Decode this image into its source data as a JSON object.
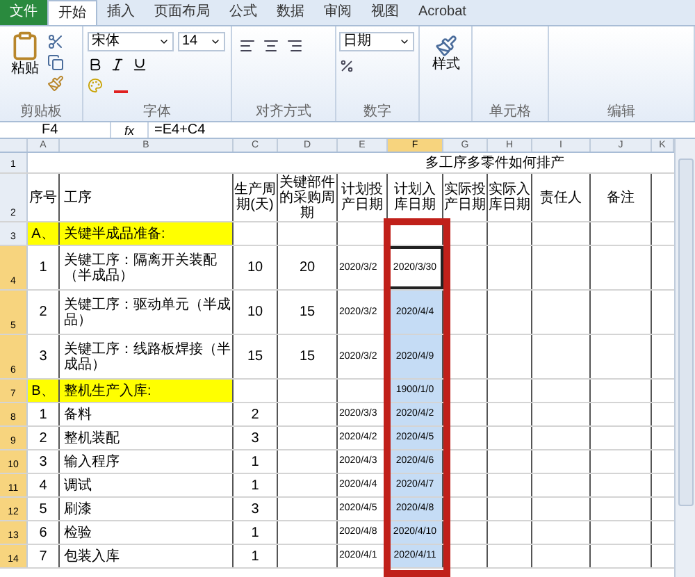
{
  "ribbon_tabs": [
    {
      "label": "文件",
      "kind": "file",
      "selected": false
    },
    {
      "label": "开始",
      "kind": "tab",
      "selected": true
    },
    {
      "label": "插入",
      "kind": "tab",
      "selected": false
    },
    {
      "label": "页面布局",
      "kind": "tab",
      "selected": false
    },
    {
      "label": "公式",
      "kind": "tab",
      "selected": false
    },
    {
      "label": "数据",
      "kind": "tab",
      "selected": false
    },
    {
      "label": "审阅",
      "kind": "tab",
      "selected": false
    },
    {
      "label": "视图",
      "kind": "tab",
      "selected": false
    },
    {
      "label": "Acrobat",
      "kind": "tab",
      "selected": false
    }
  ],
  "ribbon": {
    "paste_label": "粘贴",
    "font_name": "宋体",
    "font_size": "14",
    "number_format": "日期",
    "styles_label": "样式",
    "groups": [
      "剪贴板",
      "字体",
      "对齐方式",
      "数字",
      "单元格",
      "编辑"
    ]
  },
  "formula_bar": {
    "name_box": "F4",
    "function_label": "fx",
    "formula": "=E4+C4"
  },
  "columns": [
    {
      "label": "A",
      "selected": false
    },
    {
      "label": "B",
      "selected": false
    },
    {
      "label": "C",
      "selected": false
    },
    {
      "label": "D",
      "selected": false
    },
    {
      "label": "E",
      "selected": false
    },
    {
      "label": "F",
      "selected": true
    },
    {
      "label": "G",
      "selected": false
    },
    {
      "label": "H",
      "selected": false
    },
    {
      "label": "I",
      "selected": false
    },
    {
      "label": "J",
      "selected": false
    },
    {
      "label": "K",
      "selected": false
    }
  ],
  "rows": [
    {
      "number": "1",
      "kind": "title",
      "selected": false,
      "active": false,
      "title": "多工序多零件如何排产"
    },
    {
      "number": "2",
      "kind": "header",
      "selected": false,
      "active": false,
      "cells": [
        "序号",
        "工序",
        "生产周期(天)",
        "关键部件的采购周期",
        "计划投产日期",
        "计划入库日期",
        "实际投产日期",
        "实际入库日期",
        "责任人",
        "备注"
      ]
    },
    {
      "number": "3",
      "kind": "section",
      "selected": false,
      "active": false,
      "cells": [
        "A、",
        "关键半成品准备:",
        "",
        "",
        "",
        "",
        "",
        "",
        "",
        ""
      ]
    },
    {
      "number": "4",
      "kind": "tall",
      "selected": true,
      "active": true,
      "cells": [
        "1",
        "关键工序：隔离开关装配（半成品）",
        "10",
        "20",
        "2020/3/2",
        "2020/3/30",
        "",
        "",
        "",
        ""
      ]
    },
    {
      "number": "5",
      "kind": "tall",
      "selected": true,
      "active": false,
      "cells": [
        "2",
        "关键工序：驱动单元（半成品）",
        "10",
        "15",
        "2020/3/2",
        "2020/4/4",
        "",
        "",
        "",
        ""
      ]
    },
    {
      "number": "6",
      "kind": "tall",
      "selected": true,
      "active": false,
      "cells": [
        "3",
        "关键工序：线路板焊接（半成品）",
        "15",
        "15",
        "2020/3/2",
        "2020/4/9",
        "",
        "",
        "",
        ""
      ]
    },
    {
      "number": "7",
      "kind": "section",
      "selected": true,
      "active": false,
      "cells": [
        "B、",
        "整机生产入库:",
        "",
        "",
        "",
        "1900/1/0",
        "",
        "",
        "",
        ""
      ]
    },
    {
      "number": "8",
      "kind": "item",
      "selected": true,
      "active": false,
      "cells": [
        "1",
        "备料",
        "2",
        "",
        "2020/3/3",
        "2020/4/2",
        "",
        "",
        "",
        ""
      ]
    },
    {
      "number": "9",
      "kind": "item",
      "selected": true,
      "active": false,
      "cells": [
        "2",
        "整机装配",
        "3",
        "",
        "2020/4/2",
        "2020/4/5",
        "",
        "",
        "",
        ""
      ]
    },
    {
      "number": "10",
      "kind": "item",
      "selected": true,
      "active": false,
      "cells": [
        "3",
        "输入程序",
        "1",
        "",
        "2020/4/3",
        "2020/4/6",
        "",
        "",
        "",
        ""
      ]
    },
    {
      "number": "11",
      "kind": "item",
      "selected": true,
      "active": false,
      "cells": [
        "4",
        "调试",
        "1",
        "",
        "2020/4/4",
        "2020/4/7",
        "",
        "",
        "",
        ""
      ]
    },
    {
      "number": "12",
      "kind": "item",
      "selected": true,
      "active": false,
      "cells": [
        "5",
        "刷漆",
        "3",
        "",
        "2020/4/5",
        "2020/4/8",
        "",
        "",
        "",
        ""
      ]
    },
    {
      "number": "13",
      "kind": "item",
      "selected": true,
      "active": false,
      "cells": [
        "6",
        "检验",
        "1",
        "",
        "2020/4/8",
        "2020/4/10",
        "",
        "",
        "",
        ""
      ]
    },
    {
      "number": "14",
      "kind": "item",
      "selected": true,
      "active": false,
      "cells": [
        "7",
        "包装入库",
        "1",
        "",
        "2020/4/1",
        "2020/4/11",
        "",
        "",
        "",
        ""
      ]
    }
  ]
}
